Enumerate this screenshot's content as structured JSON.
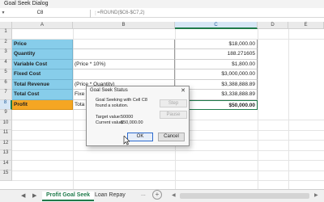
{
  "window": {
    "title": "Goal Seek Dialog"
  },
  "formula_bar": {
    "name_box": "C8",
    "formula": "=ROUND($C6-$C7,2)"
  },
  "columns": [
    "A",
    "B",
    "C",
    "D",
    "E"
  ],
  "rows": [
    "1",
    "2",
    "3",
    "4",
    "5",
    "6",
    "7",
    "8",
    "9",
    "10",
    "11",
    "12",
    "13",
    "14",
    "15"
  ],
  "table": [
    {
      "a": "Price",
      "b": "",
      "c": "$18,000.00"
    },
    {
      "a": "Quantity",
      "b": "",
      "c": "188.271605"
    },
    {
      "a": "Variable Cost",
      "b": "(Price * 10%)",
      "c": "$1,800.00"
    },
    {
      "a": "Fixed Cost",
      "b": "",
      "c": "$3,000,000.00"
    },
    {
      "a": "Total Revenue",
      "b": "(Price * Quantity)",
      "c": "$3,388,888.89"
    },
    {
      "a": "Total Cost",
      "b": "Fixe",
      "c": "$3,338,888.89"
    },
    {
      "a": "Profit",
      "b": "Tota",
      "c": "$50,000.00"
    }
  ],
  "dialog": {
    "title": "Goal Seek Status",
    "close": "✕",
    "message": "Goal Seeking with Cell C8 found a solution.",
    "target_label": "Target value:",
    "target_value": "50000",
    "current_label": "Current value:",
    "current_value": "$50,000.00",
    "step_button": "Step",
    "pause_button": "Pause",
    "ok_button": "OK",
    "cancel_button": "Cancel"
  },
  "tabs": {
    "prev": "◀",
    "next": "▶",
    "items": [
      "Profit Goal Seek",
      "Loan Repay"
    ],
    "more": "...",
    "add": "+"
  },
  "colors": {
    "label_fill": "#87cdea",
    "profit_fill": "#f5a623",
    "accent": "#1f7a4a"
  }
}
